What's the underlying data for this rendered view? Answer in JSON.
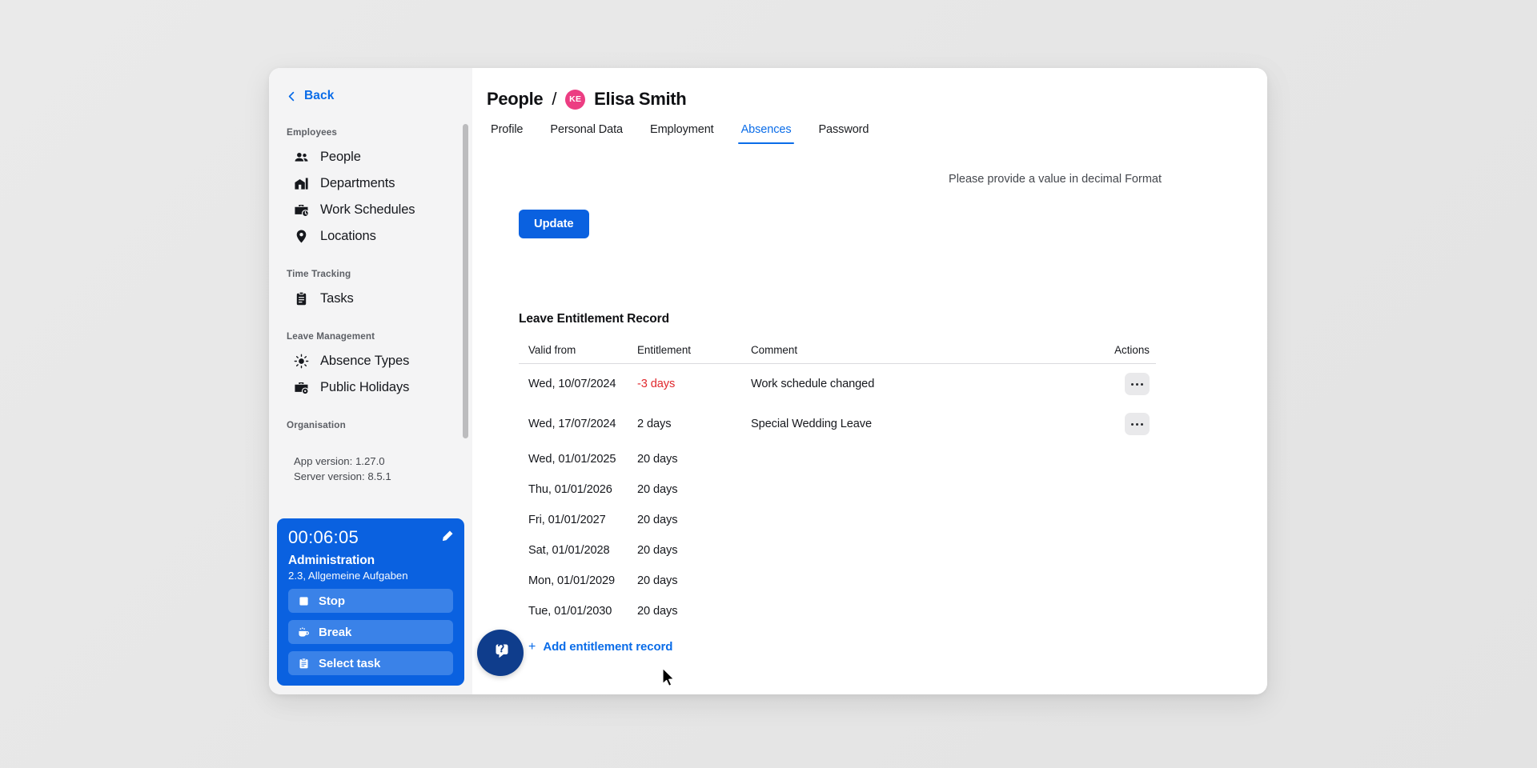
{
  "sidebar": {
    "back_label": "Back",
    "groups": [
      {
        "title": "Employees",
        "items": [
          {
            "label": "People",
            "icon": "people-icon"
          },
          {
            "label": "Departments",
            "icon": "building-icon"
          },
          {
            "label": "Work Schedules",
            "icon": "briefcase-clock-icon"
          },
          {
            "label": "Locations",
            "icon": "location-pin-icon"
          }
        ]
      },
      {
        "title": "Time Tracking",
        "items": [
          {
            "label": "Tasks",
            "icon": "clipboard-icon"
          }
        ]
      },
      {
        "title": "Leave Management",
        "items": [
          {
            "label": "Absence Types",
            "icon": "sun-icon"
          },
          {
            "label": "Public Holidays",
            "icon": "briefcase-star-icon"
          }
        ]
      },
      {
        "title": "Organisation",
        "items": []
      }
    ],
    "app_version": "App version: 1.27.0",
    "server_version": "Server version: 8.5.1"
  },
  "timer": {
    "elapsed": "00:06:05",
    "project": "Administration",
    "task": "2.3, Allgemeine Aufgaben",
    "edit_icon": "pencil-icon",
    "buttons": [
      {
        "label": "Stop",
        "icon": "stop-square-icon"
      },
      {
        "label": "Break",
        "icon": "coffee-cup-icon"
      },
      {
        "label": "Select task",
        "icon": "clipboard-icon"
      }
    ]
  },
  "header": {
    "breadcrumb_root": "People",
    "breadcrumb_separator": "/",
    "avatar_initials": "KE",
    "avatar_color": "#ec3d82",
    "person_name": "Elisa Smith"
  },
  "tabs": [
    {
      "label": "Profile",
      "active": false
    },
    {
      "label": "Personal Data",
      "active": false
    },
    {
      "label": "Employment",
      "active": false
    },
    {
      "label": "Absences",
      "active": true
    },
    {
      "label": "Password",
      "active": false
    }
  ],
  "main": {
    "hint": "Please provide a value in decimal Format",
    "update_label": "Update",
    "section_title": "Leave Entitlement Record",
    "add_label": "Add entitlement record",
    "add_plus": "+",
    "accent_color": "#0a6ce8",
    "negative_color": "#e0282d"
  },
  "table": {
    "columns": [
      "Valid from",
      "Entitlement",
      "Comment",
      "Actions"
    ],
    "rows": [
      {
        "valid_from": "Wed, 10/07/2024",
        "entitlement": "-3 days",
        "negative": true,
        "comment": "Work schedule changed",
        "has_action": true
      },
      {
        "valid_from": "Wed, 17/07/2024",
        "entitlement": "2 days",
        "negative": false,
        "comment": "Special Wedding Leave",
        "has_action": true
      },
      {
        "valid_from": "Wed, 01/01/2025",
        "entitlement": "20 days",
        "negative": false,
        "comment": "",
        "has_action": false
      },
      {
        "valid_from": "Thu, 01/01/2026",
        "entitlement": "20 days",
        "negative": false,
        "comment": "",
        "has_action": false
      },
      {
        "valid_from": "Fri, 01/01/2027",
        "entitlement": "20 days",
        "negative": false,
        "comment": "",
        "has_action": false
      },
      {
        "valid_from": "Sat, 01/01/2028",
        "entitlement": "20 days",
        "negative": false,
        "comment": "",
        "has_action": false
      },
      {
        "valid_from": "Mon, 01/01/2029",
        "entitlement": "20 days",
        "negative": false,
        "comment": "",
        "has_action": false
      },
      {
        "valid_from": "Tue, 01/01/2030",
        "entitlement": "20 days",
        "negative": false,
        "comment": "",
        "has_action": false
      }
    ]
  },
  "help": {
    "icon": "help-chat-icon"
  }
}
